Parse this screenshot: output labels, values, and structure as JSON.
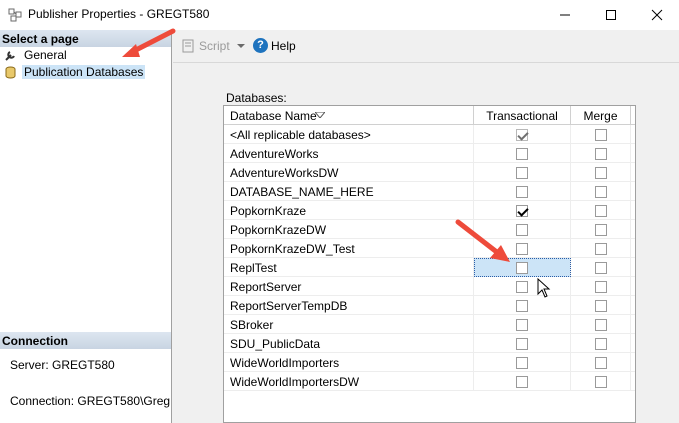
{
  "window": {
    "title": "Publisher Properties - GREGT580"
  },
  "left": {
    "select_header": "Select a page",
    "nav": [
      {
        "label": "General",
        "icon": "wrench-icon"
      },
      {
        "label": "Publication Databases",
        "icon": "database-icon"
      }
    ],
    "connection_header": "Connection",
    "server_text": "Server: GREGT580",
    "connection_text": "Connection: GREGT580\\Greg"
  },
  "toolbar": {
    "script_label": "Script",
    "help_label": "Help"
  },
  "databases": {
    "label": "Databases:",
    "columns": [
      "Database Name",
      "Transactional",
      "Merge"
    ],
    "rows": [
      {
        "name": "<All replicable databases>",
        "transactional": true,
        "merge": false
      },
      {
        "name": "AdventureWorks",
        "transactional": false,
        "merge": false
      },
      {
        "name": "AdventureWorksDW",
        "transactional": false,
        "merge": false
      },
      {
        "name": "DATABASE_NAME_HERE",
        "transactional": false,
        "merge": false
      },
      {
        "name": "PopkornKraze",
        "transactional": true,
        "merge": false
      },
      {
        "name": "PopkornKrazeDW",
        "transactional": false,
        "merge": false
      },
      {
        "name": "PopkornKrazeDW_Test",
        "transactional": false,
        "merge": false
      },
      {
        "name": "ReplTest",
        "transactional": false,
        "merge": false
      },
      {
        "name": "ReportServer",
        "transactional": false,
        "merge": false
      },
      {
        "name": "ReportServerTempDB",
        "transactional": false,
        "merge": false
      },
      {
        "name": "SBroker",
        "transactional": false,
        "merge": false
      },
      {
        "name": "SDU_PublicData",
        "transactional": false,
        "merge": false
      },
      {
        "name": "WideWorldImporters",
        "transactional": false,
        "merge": false
      },
      {
        "name": "WideWorldImportersDW",
        "transactional": false,
        "merge": false
      }
    ]
  },
  "colors": {
    "annotation_arrow": "#ee4b3b",
    "selection": "#cce4f7",
    "section_header": "#d3dde9"
  }
}
